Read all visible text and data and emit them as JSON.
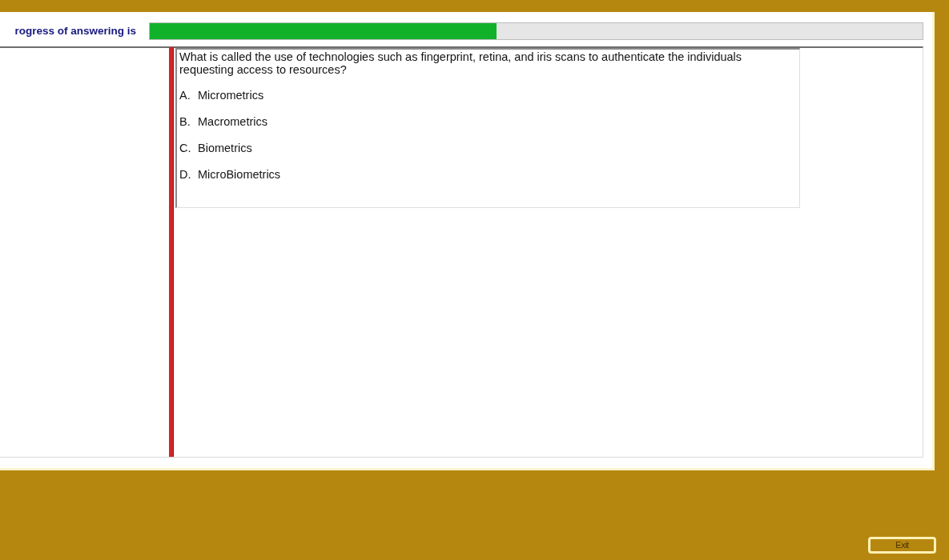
{
  "progress": {
    "label": "rogress of answering is",
    "level": 0.449
  },
  "question": {
    "text": "What is called the use of technologies such as fingerprint, retina, and iris scans to authenticate the individuals requesting access to resources?",
    "options": [
      {
        "letter": "A.",
        "text": "Micrometrics"
      },
      {
        "letter": "B.",
        "text": "Macrometrics"
      },
      {
        "letter": "C.",
        "text": "Biometrics"
      },
      {
        "letter": "D.",
        "text": "MicroBiometrics"
      }
    ]
  },
  "exit_button": {
    "label": "Exit"
  }
}
